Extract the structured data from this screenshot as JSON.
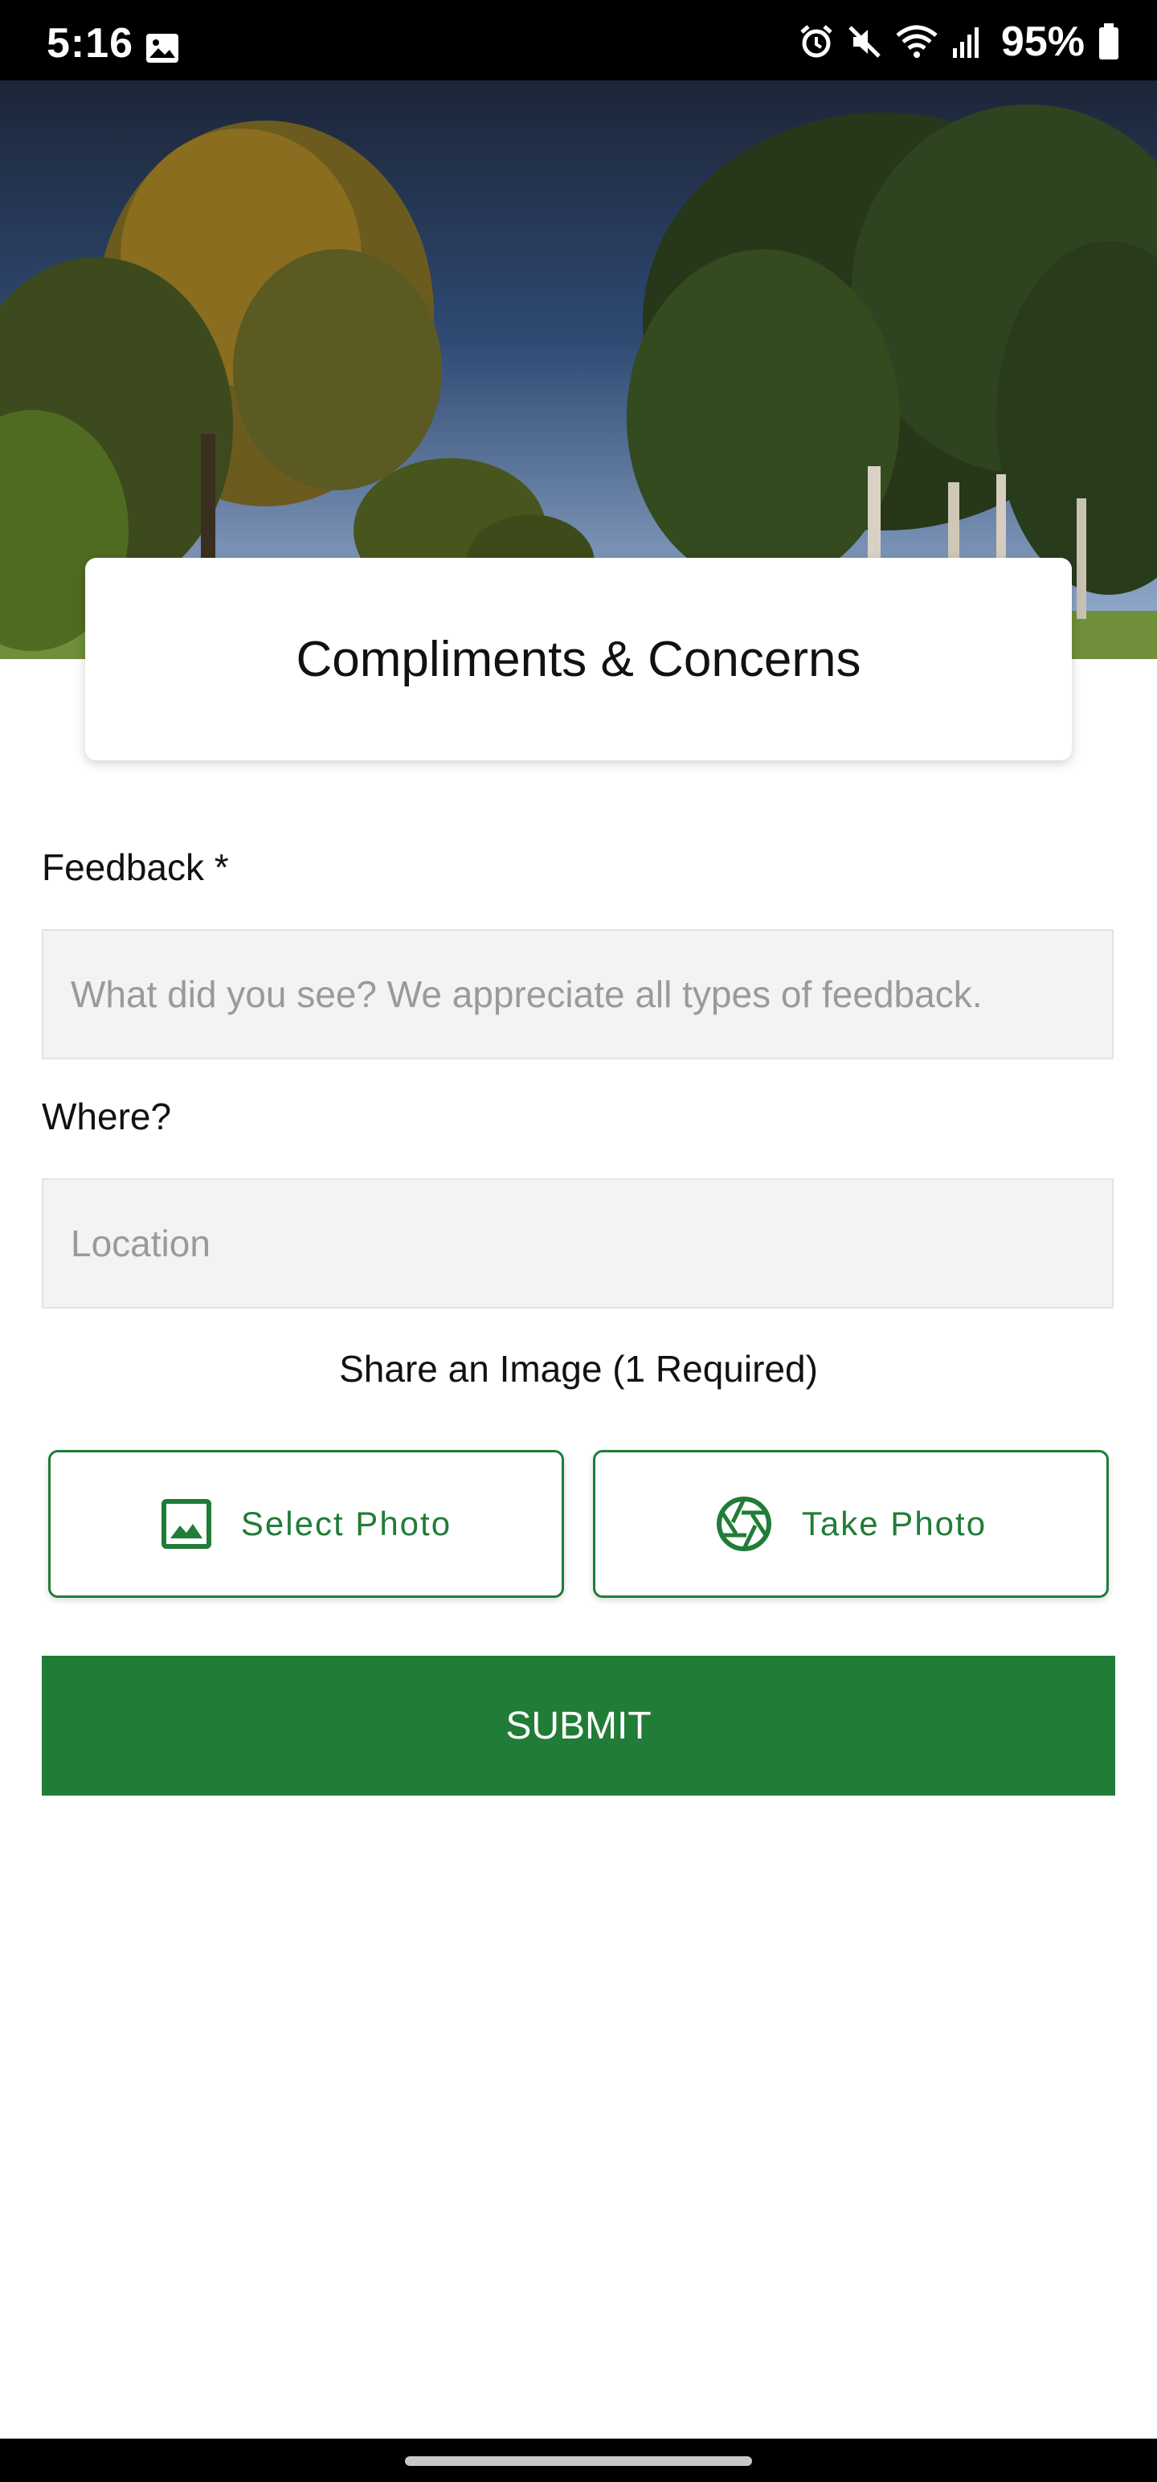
{
  "status_bar": {
    "time": "5:16",
    "battery_percent": "95%",
    "icons": [
      "gallery-icon",
      "alarm-icon",
      "mute-icon",
      "wifi-icon",
      "signal-icon",
      "battery-icon"
    ]
  },
  "header": {
    "title": "Compliments & Concerns"
  },
  "form": {
    "feedback_label": "Feedback *",
    "feedback_placeholder": "What did you see? We appreciate all types of feedback.",
    "where_label": "Where?",
    "location_placeholder": "Location",
    "share_label": "Share an Image (1 Required)",
    "select_photo_label": "Select Photo",
    "take_photo_label": "Take Photo",
    "submit_label": "SUBMIT"
  },
  "colors": {
    "accent": "#217c37",
    "input_bg": "#f4f3f2"
  }
}
